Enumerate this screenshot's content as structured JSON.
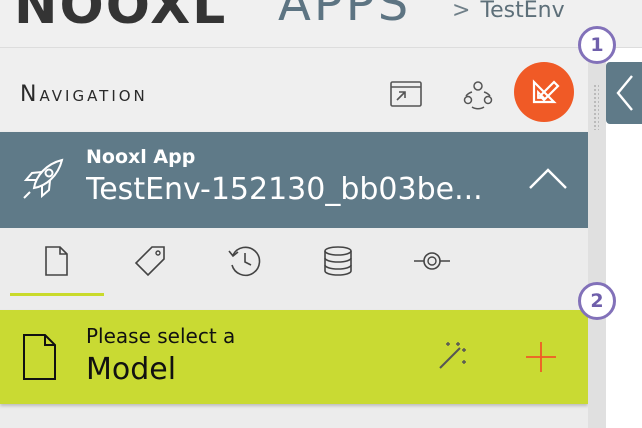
{
  "header": {
    "logo_text": "NOOXL",
    "apps_text": "APPS",
    "breadcrumb_sep": ">",
    "breadcrumb": "TestEnv"
  },
  "navigation": {
    "title": "Navigation"
  },
  "app": {
    "subtitle": "Nooxl App",
    "name": "TestEnv-152130_bb03be..."
  },
  "model": {
    "prompt": "Please select a",
    "label": "Model"
  },
  "badges": {
    "one": "1",
    "two": "2"
  },
  "colors": {
    "accent_orange": "#f05a26",
    "slate": "#5f7a88",
    "lime": "#c9da33",
    "badge_purple": "#8271b9"
  },
  "icons": {
    "header": [
      "window-link-icon",
      "collaboration-icon",
      "edit-ruler-icon"
    ],
    "tabs": [
      "document-icon",
      "tag-icon",
      "history-icon",
      "database-icon",
      "source-commit-icon"
    ],
    "model": [
      "document-icon",
      "magic-wand-icon",
      "add-icon"
    ]
  }
}
